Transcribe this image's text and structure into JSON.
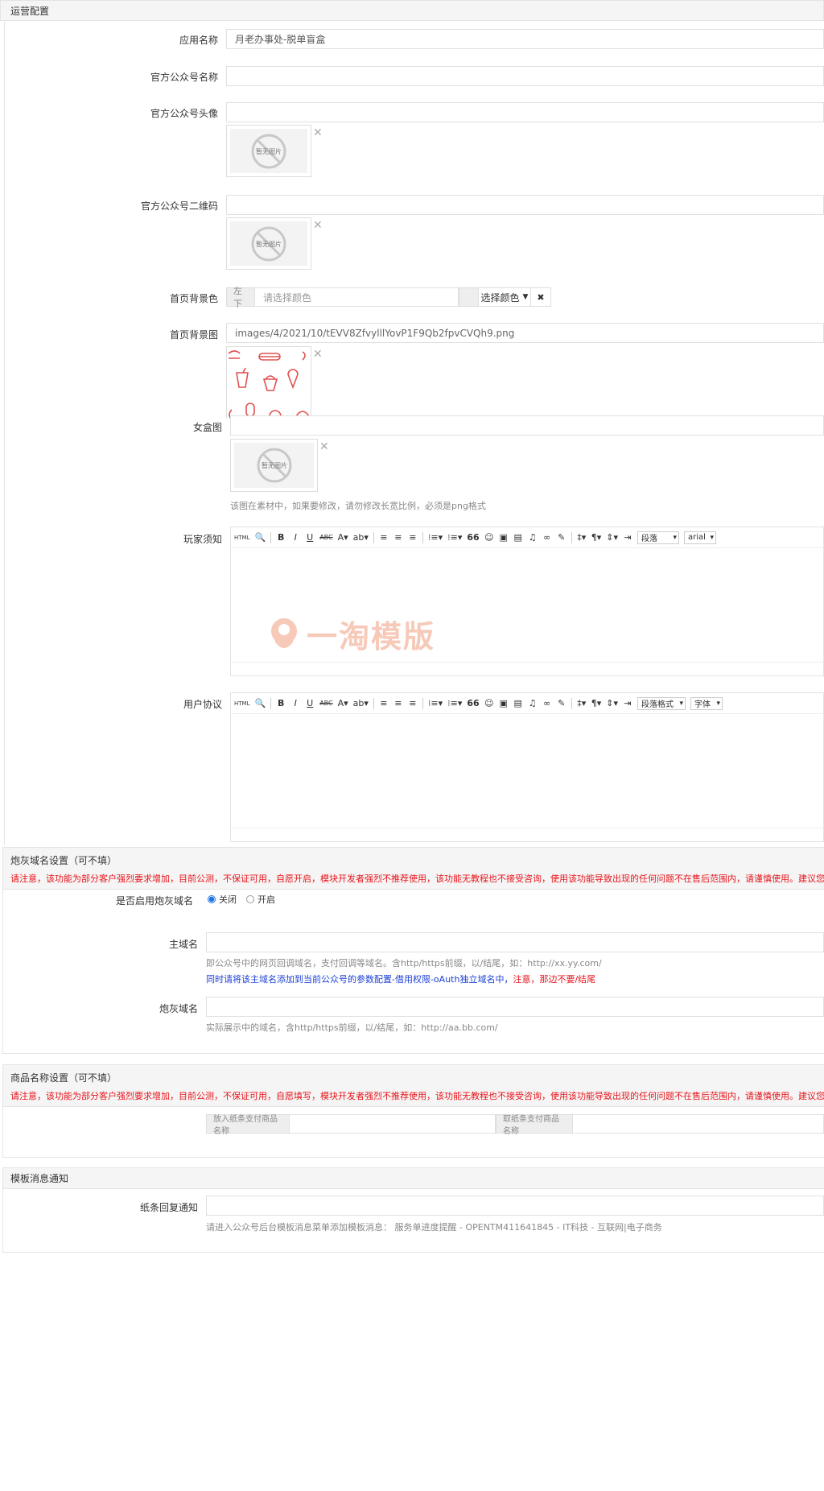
{
  "panels": {
    "operation": {
      "title": "运营配置"
    },
    "ash_domain": {
      "title": "炮灰域名设置（可不填）",
      "warning": "请注意，该功能为部分客户强烈要求增加，目前公测，不保证可用，自愿开启，模块开发者强烈不推荐使用，该功能无教程也不接受咨询，使用该功能导致出现的任何问题不在售后范围内，请谨慎使用。建议您合法合"
    },
    "goods_name": {
      "title": "商品名称设置（可不填）",
      "warning": "请注意，该功能为部分客户强烈要求增加，目前公测，不保证可用，自愿填写，模块开发者强烈不推荐使用，该功能无教程也不接受咨询，使用该功能导致出现的任何问题不在售后范围内，请谨慎使用。建议您合法合"
    },
    "template_msg": {
      "title": "模板消息通知"
    }
  },
  "fields": {
    "app_name": {
      "label": "应用名称",
      "value": "月老办事处-脱单盲盒"
    },
    "official_name": {
      "label": "官方公众号名称",
      "value": ""
    },
    "official_avatar": {
      "label": "官方公众号头像",
      "value": "",
      "thumb_text": "暂无图片"
    },
    "official_qrcode": {
      "label": "官方公众号二维码",
      "value": "",
      "thumb_text": "暂无图片"
    },
    "home_bg_color": {
      "label": "首页背景色",
      "addon": "左下",
      "placeholder": "请选择颜色",
      "choose_button": "选择颜色",
      "clear_icon": "✖"
    },
    "home_bg_image": {
      "label": "首页背景图",
      "value": "images/4/2021/10/tEVV8ZfvylllYovP1F9Qb2fpvCVQh9.png"
    },
    "female_box": {
      "label": "女盒图",
      "value": "",
      "thumb_text": "暂无图片",
      "help": "该图在素材中，如果要修改，请勿修改长宽比例，必须是png格式"
    },
    "player_notice": {
      "label": "玩家须知",
      "format_select": "段落",
      "font_select": "arial"
    },
    "user_agreement": {
      "label": "用户协议",
      "format_select": "段落格式",
      "font_select": "字体"
    },
    "enable_ash": {
      "label": "是否启用炮灰域名",
      "option_off": "关闭",
      "option_on": "开启",
      "selected": "关闭"
    },
    "main_domain": {
      "label": "主域名",
      "value": "",
      "help": "即公众号中的网页回调域名，支付回调等域名。含http/https前缀，以/结尾，如：http://xx.yy.com/",
      "help2_blue": "同时请将该主域名添加到当前公众号的参数配置-借用权限-oAuth独立域名中，",
      "help2_red": "注意，那边不要/结尾"
    },
    "ash_domain": {
      "label": "炮灰域名",
      "value": "",
      "help": "实际展示中的域名，含http/https前缀，以/结尾，如：http://aa.bb.com/"
    },
    "goods_put": {
      "addon": "放入纸条支付商品名称",
      "value": ""
    },
    "goods_take": {
      "addon": "取纸条支付商品名称",
      "value": ""
    },
    "reply_notice": {
      "label": "纸条回复通知",
      "value": "",
      "help": "请进入公众号后台模板消息菜单添加模板消息：  服务单进度提醒 - OPENTM411641845 - IT科技 - 互联网|电子商务"
    }
  },
  "watermark": {
    "text": "一淘模版"
  },
  "colors": {
    "warning": "#e8141b",
    "radio_accent": "#1e73e8",
    "watermark": "#f6c9b8"
  }
}
